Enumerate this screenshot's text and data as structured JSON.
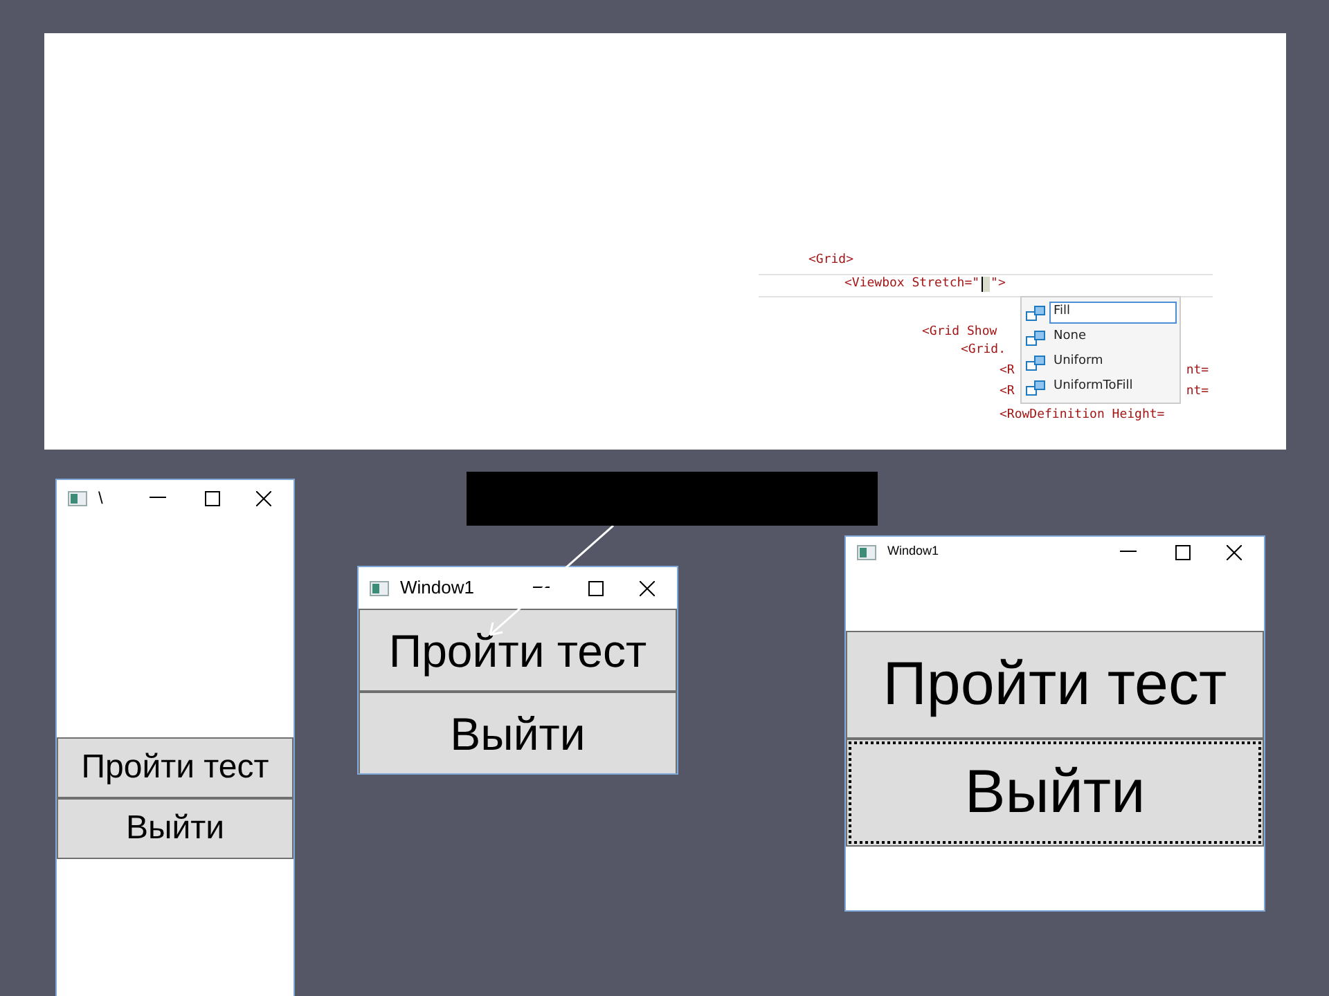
{
  "code_editor": {
    "lines": [
      {
        "kind": "plain",
        "text": "<Grid>"
      },
      {
        "kind": "cursor",
        "text": "<Viewbox Stretch=\"",
        "after": "\">"
      },
      {
        "kind": "plain",
        "text": "<Grid Show"
      },
      {
        "kind": "plain",
        "text": "<Grid."
      },
      {
        "kind": "split",
        "text": "<R",
        "after": "nt="
      },
      {
        "kind": "split",
        "text": "<R",
        "after": "nt="
      },
      {
        "kind": "plain",
        "text": "<RowDefinition Height="
      }
    ],
    "completion_items": [
      {
        "label": "Fill",
        "selected": true
      },
      {
        "label": "None",
        "selected": false
      },
      {
        "label": "Uniform",
        "selected": false
      },
      {
        "label": "UniformToFill",
        "selected": false
      }
    ]
  },
  "windows": [
    {
      "title": "\\",
      "buttons": [
        {
          "label": "Пройти тест",
          "focused": false
        },
        {
          "label": "Выйти",
          "focused": false
        }
      ]
    },
    {
      "title": "Window1",
      "buttons": [
        {
          "label": "Пройти тест",
          "focused": false
        },
        {
          "label": "Выйти",
          "focused": false
        }
      ]
    },
    {
      "title": "Window1",
      "buttons": [
        {
          "label": "Пройти тест",
          "focused": false
        },
        {
          "label": "Выйти",
          "focused": true
        }
      ]
    }
  ]
}
